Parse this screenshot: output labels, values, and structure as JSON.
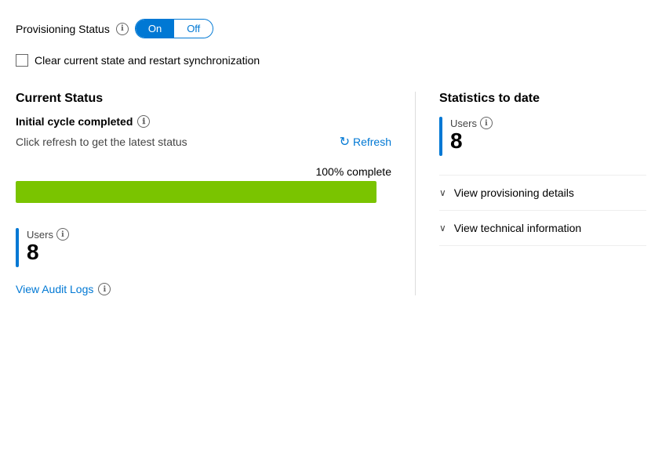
{
  "provisioning_status": {
    "label": "Provisioning Status",
    "info_icon": "ℹ",
    "toggle": {
      "on_label": "On",
      "off_label": "Off",
      "active": "on"
    }
  },
  "checkbox": {
    "label": "Clear current state and restart synchronization",
    "checked": false
  },
  "current_status": {
    "title": "Current Status",
    "cycle_label": "Initial cycle completed",
    "cycle_info": "ℹ",
    "refresh_text": "Click refresh to get the latest status",
    "refresh_label": "Refresh",
    "progress_percent": "100% complete",
    "progress_value": 100
  },
  "users_stat_left": {
    "label": "Users",
    "info": "ℹ",
    "count": "8"
  },
  "audit_logs": {
    "label": "View Audit Logs",
    "info": "ℹ"
  },
  "statistics": {
    "title": "Statistics to date",
    "users": {
      "label": "Users",
      "info": "ℹ",
      "count": "8"
    },
    "expand_items": [
      {
        "label": "View provisioning details"
      },
      {
        "label": "View technical information"
      }
    ]
  }
}
